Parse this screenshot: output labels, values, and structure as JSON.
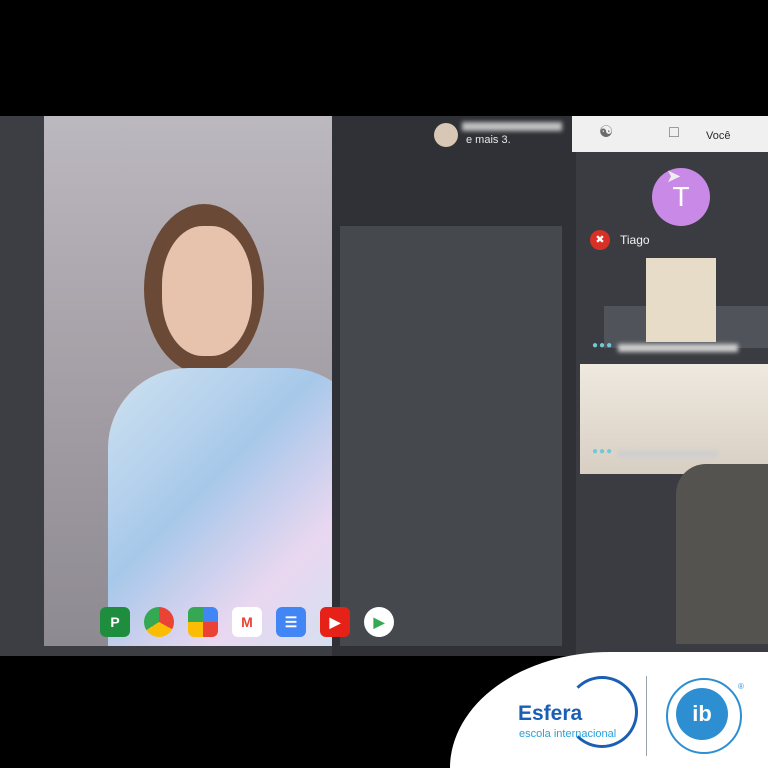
{
  "header": {
    "presenter_line2": "e mais 3.",
    "voce_label": "Você"
  },
  "participants": {
    "avatar_letter": "T",
    "muted_name": "Tiago"
  },
  "dock": {
    "apps": [
      "P",
      "Chrome",
      "Photos",
      "Gmail",
      "Docs",
      "YouTube",
      "Play"
    ]
  },
  "branding": {
    "esfera_name": "Esfera",
    "esfera_tagline": "escola internacional",
    "ib_mark": "ib"
  },
  "colors": {
    "avatar_bg": "#c88ae6",
    "mute_red": "#d93025",
    "esfera_blue": "#1a5fb4",
    "ib_blue": "#2d8fd2"
  }
}
